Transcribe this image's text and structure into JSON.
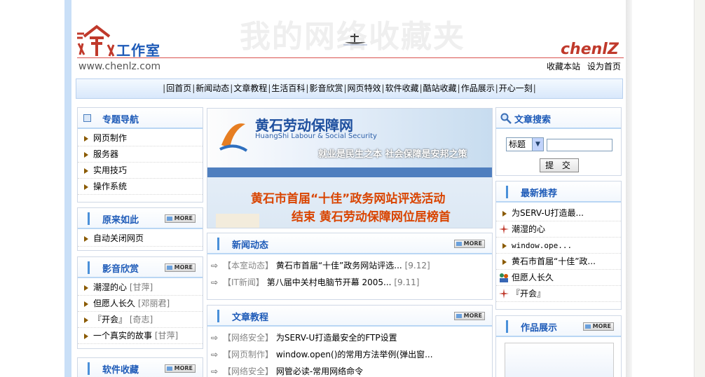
{
  "header": {
    "logo_text": "工作室",
    "banner_text": "我的网络收藏夹",
    "brand": "chenlZ",
    "domain": "www.chenlz.com",
    "links": [
      "收藏本站",
      "设为首页"
    ]
  },
  "nav": [
    "回首页",
    "新闻动态",
    "文章教程",
    "生活百科",
    "影音欣赏",
    "网页特效",
    "软件收藏",
    "酷站收藏",
    "作品展示",
    "开心一刻"
  ],
  "more_label": "MORE",
  "left": {
    "topics": {
      "title": "专题导航",
      "items": [
        "网页制作",
        "服务器",
        "实用技巧",
        "操作系统"
      ]
    },
    "yuanlai": {
      "title": "原来如此",
      "items": [
        "自动关闭网页"
      ]
    },
    "media": {
      "title": "影音欣赏",
      "items": [
        {
          "t": "潮湿的心",
          "a": "[甘萍]"
        },
        {
          "t": "但愿人长久",
          "a": "[邓丽君]"
        },
        {
          "t": "『开会』",
          "a": "[奇志]"
        },
        {
          "t": "一个真实的故事",
          "a": "[甘萍]"
        }
      ]
    },
    "soft": {
      "title": "软件收藏"
    }
  },
  "hero": {
    "title": "黄石劳动保障网",
    "sub": "HuangShi Labour & Social Security",
    "slogan": "就业是民生之本  社会保障是安邦之策",
    "cap1": "黄石市首届“十佳”政务网站评选活动",
    "cap2": "结束   黄石劳动保障网位居榜首"
  },
  "news": {
    "title": "新闻动态",
    "items": [
      {
        "tag": "【本室动态】",
        "t": "黄石市首届“十佳”政务网站评选...",
        "d": "[9.12]"
      },
      {
        "tag": "【IT新闻】",
        "t": "第八届中关村电脑节开幕 2005...",
        "d": "[9.11]"
      }
    ]
  },
  "articles": {
    "title": "文章教程",
    "items": [
      {
        "tag": "【网络安全】",
        "t": "为SERV-U打造最安全的FTP设置"
      },
      {
        "tag": "【网页制作】",
        "t": "window.open()的常用方法举例(弹出窗..."
      },
      {
        "tag": "【网络安全】",
        "t": "网管必读-常用网络命令"
      }
    ]
  },
  "right": {
    "search": {
      "title": "文章搜索",
      "option": "标题",
      "button": "提 交"
    },
    "recommend": {
      "title": "最新推荐",
      "items": [
        "为SERV-U打造最...",
        "潮湿的心",
        "window.ope...",
        "黄石市首届“十佳”政...",
        "但愿人长久",
        "『开会』"
      ]
    },
    "works": {
      "title": "作品展示"
    }
  }
}
